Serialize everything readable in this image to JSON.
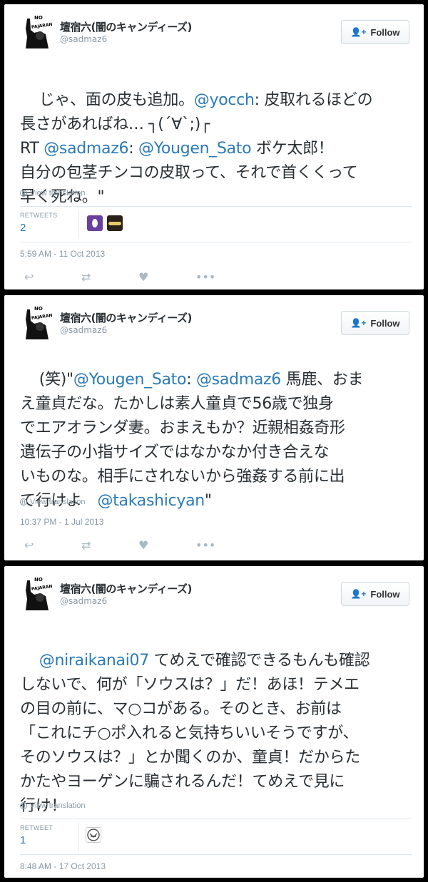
{
  "tweets": [
    {
      "name": "壇宿六(闇のキャンディーズ)",
      "handle": "@sadmaz6",
      "follow_label": "Follow",
      "text_parts": [
        {
          "t": "じゃ、面の皮も追加。"
        },
        {
          "t": "@yocch",
          "mention": true
        },
        {
          "t": ": 皮取れるほどの\n長さがあればね… ┐(´∀`;)┌\nRT "
        },
        {
          "t": "@sadmaz6",
          "mention": true
        },
        {
          "t": ": "
        },
        {
          "t": "@Yougen_Sato",
          "mention": true
        },
        {
          "t": " ボケ太郎！\n自分の包茎チンコの皮取って、それで首くくって\n早く死ね。\""
        }
      ],
      "translate_label": "View translation",
      "stats_label": "RETWEETS",
      "stats_count": "2",
      "timestamp": "5:59 AM - 11 Oct 2013"
    },
    {
      "name": "壇宿六(闇のキャンディーズ)",
      "handle": "@sadmaz6",
      "follow_label": "Follow",
      "text_parts": [
        {
          "t": "(笑)\""
        },
        {
          "t": "@Yougen_Sato",
          "mention": true
        },
        {
          "t": ": "
        },
        {
          "t": "@sadmaz6",
          "mention": true
        },
        {
          "t": " 馬鹿、おま\nえ童貞だな。たかしは素人童貞で56歳で独身\nでエアオランダ妻。おまえもか？近親相姦奇形\n遺伝子の小指サイズではなかなか付き合えな\nいものな。相手にされないから強姦する前に出\nて行けよ　"
        },
        {
          "t": "@takashicyan",
          "mention": true
        },
        {
          "t": "\""
        }
      ],
      "translate_label": "View translation",
      "timestamp": "10:37 PM - 1 Jul 2013"
    },
    {
      "name": "壇宿六(闇のキャンディーズ)",
      "handle": "@sadmaz6",
      "follow_label": "Follow",
      "text_parts": [
        {
          "t": "@niraikanai07",
          "mention": true
        },
        {
          "t": " てめえで確認できるもんも確認\nしないで、何が「ソウスは？」だ！あほ！テメエ\nの目の前に、マ○コがある。そのとき、お前は\n「これにチ○ポ入れると気持ちいいそうですが、\nそのソウスは？」とか聞くのか、童貞！だからた\nかたやヨーゲンに騙されるんだ！てめえで見に\n行け！"
        }
      ],
      "translate_label": "View translation",
      "stats_label": "RETWEET",
      "stats_count": "1",
      "timestamp": "8:48 AM - 17 Oct 2013"
    }
  ],
  "avatar_text": {
    "top": "NO",
    "bottom": "PAJARAN"
  },
  "colors": {
    "link": "#2b7bb9",
    "muted": "#8899a6",
    "icon": "#aab8c2"
  }
}
